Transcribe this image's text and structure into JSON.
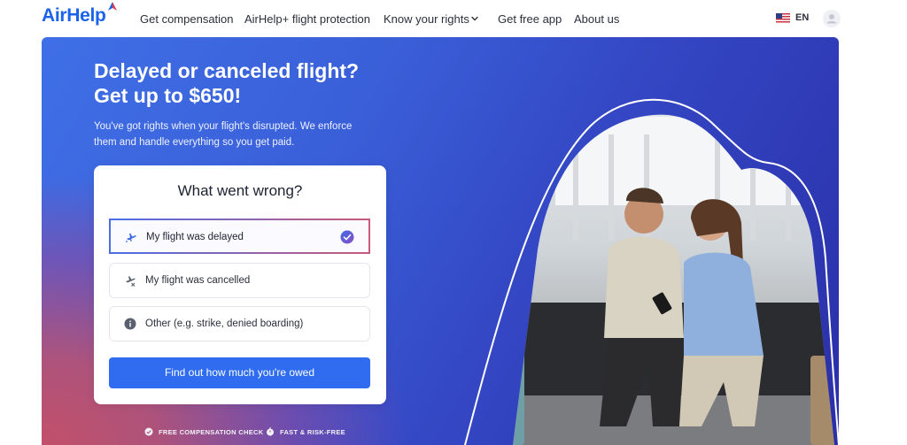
{
  "header": {
    "logo": "AirHelp",
    "nav": [
      {
        "label": "Get compensation"
      },
      {
        "label": "AirHelp+ flight protection"
      },
      {
        "label": "Know your rights"
      },
      {
        "label": "Get free app"
      },
      {
        "label": "About us"
      }
    ],
    "language": "EN"
  },
  "hero": {
    "title_line1": "Delayed or canceled flight?",
    "title_line2": "Get up to $650!",
    "subtitle_line1": "You've got rights when your flight's disrupted. We enforce",
    "subtitle_line2": "them and handle everything so you get paid."
  },
  "form": {
    "title": "What went wrong?",
    "options": [
      {
        "label": "My flight was delayed",
        "icon": "plane-delayed-icon",
        "selected": true
      },
      {
        "label": "My flight was cancelled",
        "icon": "plane-cancelled-icon",
        "selected": false
      },
      {
        "label": "Other (e.g. strike, denied boarding)",
        "icon": "info-icon",
        "selected": false
      }
    ],
    "cta": "Find out how much you're owed"
  },
  "features": [
    {
      "label": "FREE COMPENSATION CHECK",
      "icon": "check-circle-icon"
    },
    {
      "label": "FAST & RISK-FREE",
      "icon": "stopwatch-icon"
    }
  ],
  "colors": {
    "brand": "#1b63e8",
    "cta": "#2f6cf0",
    "hero_blue": "#3447c4",
    "hero_pink": "#c2506a"
  }
}
